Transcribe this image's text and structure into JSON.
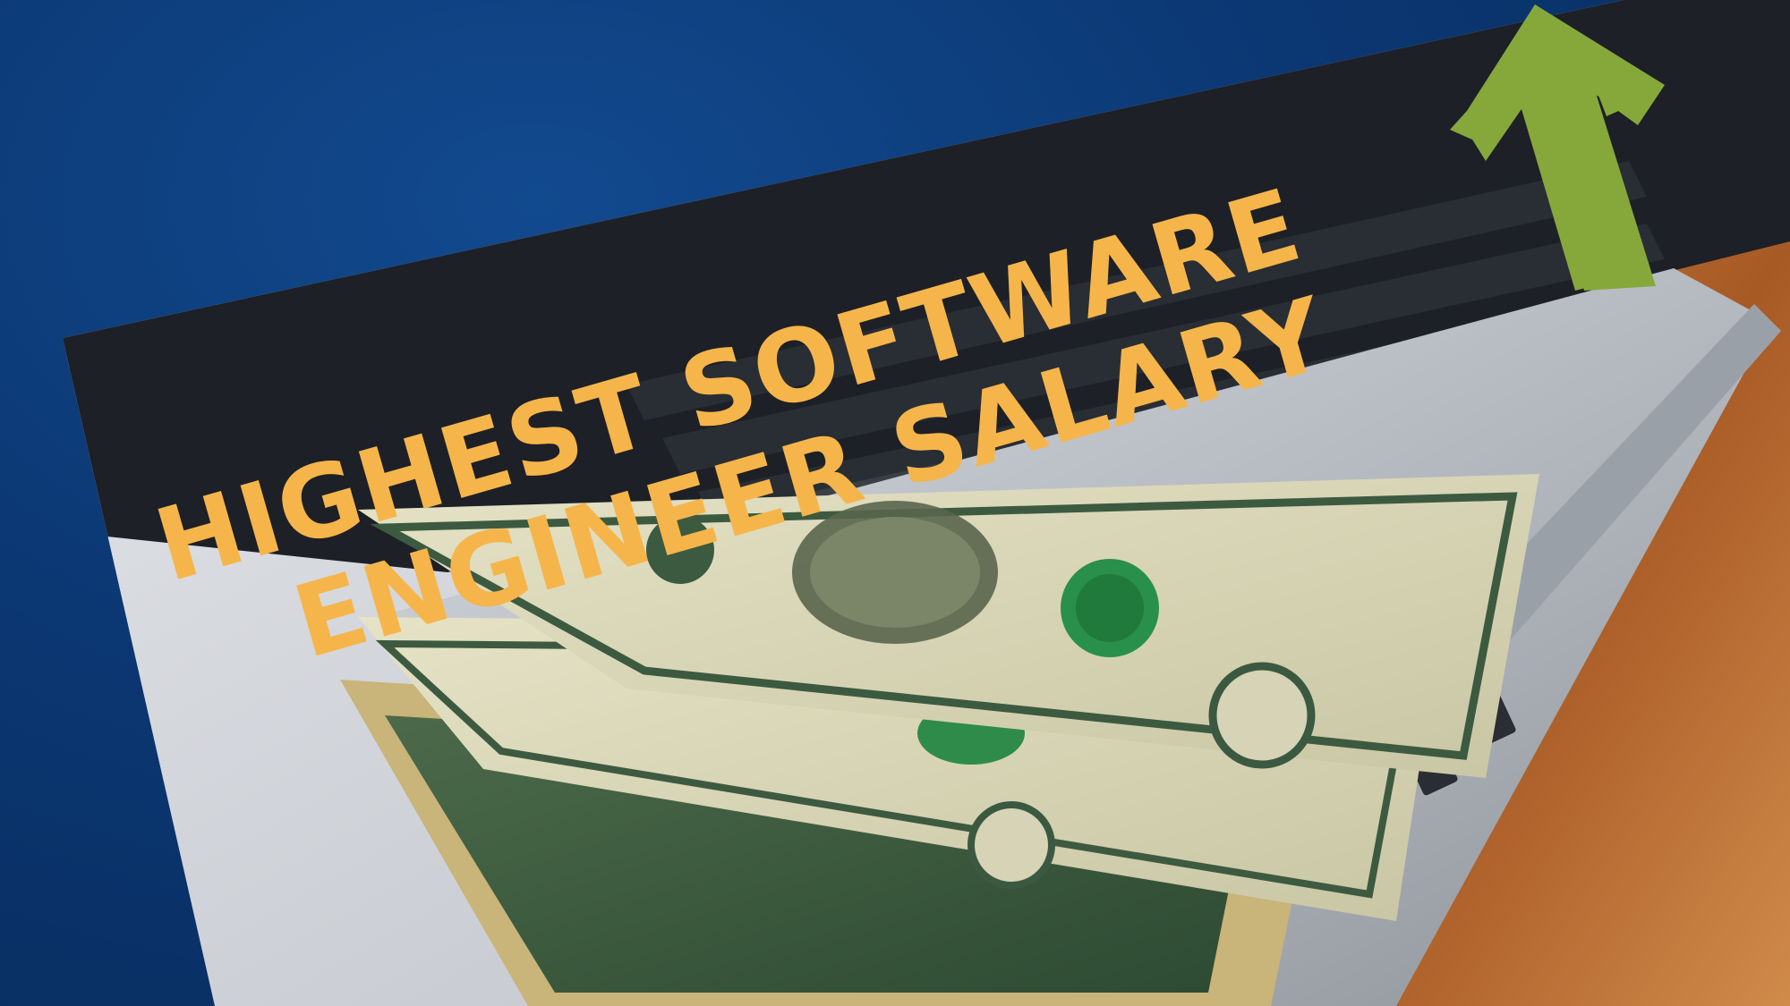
{
  "headline": {
    "line1": "HIGHEST SOFTWARE",
    "line2": "ENGINEER SALARY"
  },
  "colors": {
    "background": "#0b3772",
    "headline_text": "#f6b54a",
    "arrow": "#86a83b",
    "desk_wood": "#b8662c",
    "laptop_silver": "#bfc4cc",
    "keyboard": "#1f2227",
    "banknote": "#d8d6b8"
  },
  "icons": {
    "arrow": "up-arrow-icon"
  }
}
